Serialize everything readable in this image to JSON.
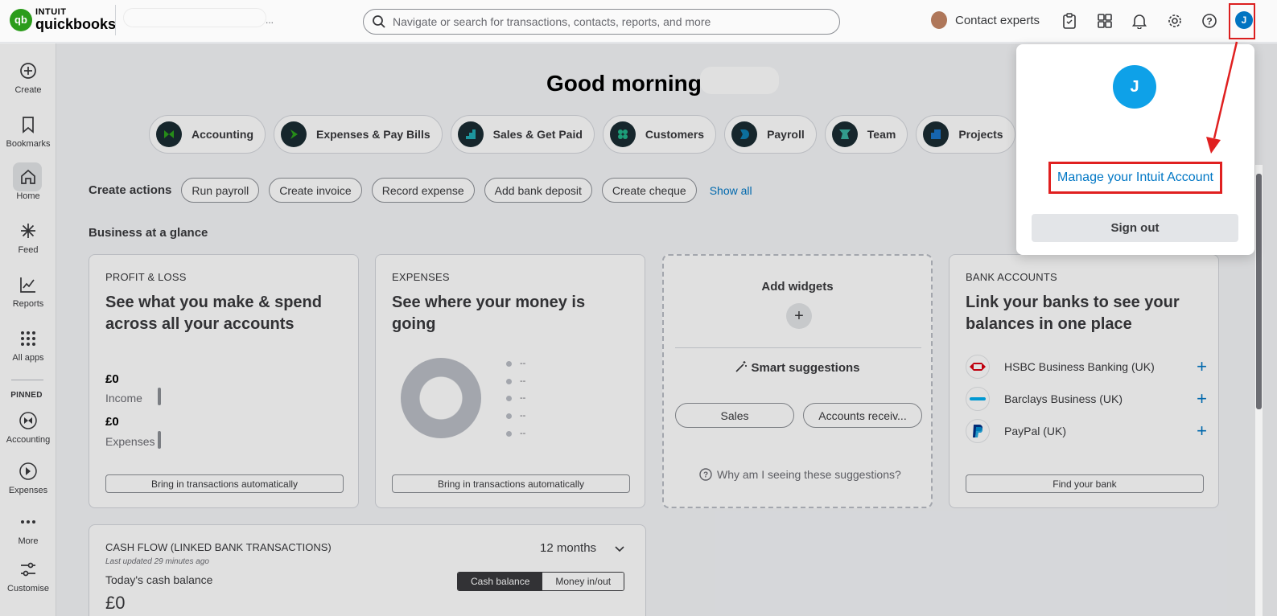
{
  "header": {
    "brand_top": "INTUIT",
    "brand_name": "quickbooks",
    "company_suffix": "...",
    "search_placeholder": "Navigate or search for transactions, contacts, reports, and more",
    "contact_label": "Contact experts",
    "user_initial": "J"
  },
  "sidebar": {
    "items": [
      {
        "label": "Create",
        "icon": "plus-circle-icon"
      },
      {
        "label": "Bookmarks",
        "icon": "bookmark-icon"
      },
      {
        "label": "Home",
        "icon": "home-icon"
      },
      {
        "label": "Feed",
        "icon": "feed-icon"
      },
      {
        "label": "Reports",
        "icon": "reports-icon"
      },
      {
        "label": "All apps",
        "icon": "grid-icon"
      }
    ],
    "pinned_label": "PINNED",
    "pinned": [
      {
        "label": "Accounting",
        "icon": "accounting-icon"
      },
      {
        "label": "Expenses",
        "icon": "expenses-icon"
      },
      {
        "label": "More",
        "icon": "more-icon"
      },
      {
        "label": "Customise",
        "icon": "sliders-icon"
      }
    ]
  },
  "main": {
    "greeting": "Good morning",
    "pills": [
      "Accounting",
      "Expenses & Pay Bills",
      "Sales & Get Paid",
      "Customers",
      "Payroll",
      "Team",
      "Projects"
    ],
    "create_actions": {
      "title": "Create actions",
      "buttons": [
        "Run payroll",
        "Create invoice",
        "Record expense",
        "Add bank deposit",
        "Create cheque"
      ],
      "show_all": "Show all"
    },
    "glance_title": "Business at a glance",
    "profit_loss": {
      "label": "PROFIT & LOSS",
      "headline": "See what you make & spend across all your accounts",
      "income_value": "£0",
      "income_label": "Income",
      "expenses_value": "£0",
      "expenses_label": "Expenses",
      "button": "Bring in transactions automatically"
    },
    "expenses": {
      "label": "EXPENSES",
      "headline": "See where your money is going",
      "legend": [
        "--",
        "--",
        "--",
        "--",
        "--"
      ],
      "button": "Bring in transactions automatically"
    },
    "widgets": {
      "title": "Add widgets",
      "plus": "+",
      "smart_title": "Smart suggestions",
      "suggestions": [
        "Sales",
        "Accounts receiv..."
      ],
      "why": "Why am I seeing these suggestions?"
    },
    "bank_accounts": {
      "label": "BANK ACCOUNTS",
      "headline": "Link your banks to see your balances in one place",
      "banks": [
        {
          "name": "HSBC Business Banking (UK)",
          "add": "+"
        },
        {
          "name": "Barclays Business (UK)",
          "add": "+"
        },
        {
          "name": "PayPal (UK)",
          "add": "+"
        }
      ],
      "button": "Find your bank"
    },
    "cash_flow": {
      "title": "CASH FLOW (LINKED BANK TRANSACTIONS)",
      "updated": "Last updated 29 minutes ago",
      "today_label": "Today's cash balance",
      "value": "£0",
      "period": "12 months",
      "toggle": [
        "Cash balance",
        "Money in/out"
      ]
    }
  },
  "popup": {
    "initial": "J",
    "manage_link": "Manage your Intuit Account",
    "sign_out": "Sign out"
  },
  "colors": {
    "brand_green": "#2ca01c",
    "link_blue": "#0077c5",
    "avatar_blue": "#0ea1e8",
    "annotation_red": "#e02020"
  }
}
